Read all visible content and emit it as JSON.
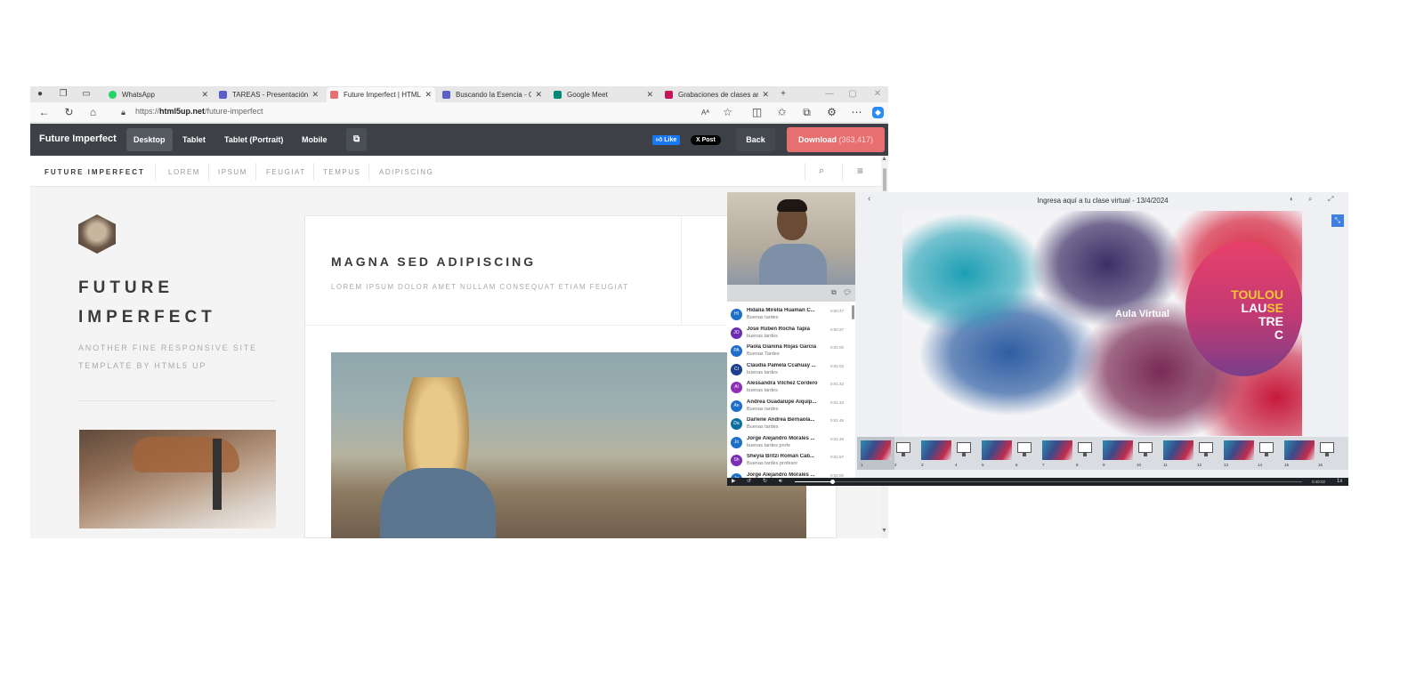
{
  "browser": {
    "tabs": [
      {
        "label": "WhatsApp",
        "color": "#25d366"
      },
      {
        "label": "TAREAS - Presentación",
        "color": "#5b5fc7"
      },
      {
        "label": "Future Imperfect | HTML",
        "color": "#e76f6f"
      },
      {
        "label": "Buscando la Esencia - Gr",
        "color": "#5b5fc7"
      },
      {
        "label": "Google Meet",
        "color": "#00897b"
      },
      {
        "label": "Grabaciones de clases ar",
        "color": "#c2185b"
      }
    ],
    "new_tab": "+",
    "url_prefix": "https://",
    "url_host": "html5up.net",
    "url_path": "/future-imperfect"
  },
  "html5up_bar": {
    "logo": "Future Imperfect",
    "view_buttons": [
      "Desktop",
      "Tablet",
      "Tablet (Portrait)",
      "Mobile"
    ],
    "like": "Like",
    "post": "X Post",
    "back": "Back",
    "download": "Download",
    "download_count": "(363,417)"
  },
  "site": {
    "title": "FUTURE IMPERFECT",
    "nav": [
      "LOREM",
      "IPSUM",
      "FEUGIAT",
      "TEMPUS",
      "ADIPISCING"
    ],
    "brand_line1": "FUTURE",
    "brand_line2": "IMPERFECT",
    "brand_sub": "ANOTHER FINE RESPONSIVE SITE TEMPLATE BY HTML5 UP",
    "post_title": "MAGNA SED ADIPISCING",
    "post_sub": "LOREM IPSUM DOLOR AMET NULLAM CONSEQUAT ETIAM FEUGIAT"
  },
  "player": {
    "title": "Ingresa aquí a tu clase virtual - 13/4/2024",
    "slide_text": "Aula Virtual",
    "logo_l1": "TOULOU",
    "logo_l2a": "LAU",
    "logo_l2b": "SE",
    "logo_l3": "TRE",
    "logo_l4": "C",
    "time": "0:40:02",
    "speed": "1x",
    "chat": [
      {
        "initials": "HI",
        "name": "Hidalia Mirella Huaman C...",
        "time": "0:00:47",
        "msg": "Buenas tardes",
        "color": "#1e6fc9"
      },
      {
        "initials": "JO",
        "name": "Jose Ruben Rocha Tapia",
        "time": "0:00:37",
        "msg": "buenas tardes",
        "color": "#6a2eb5"
      },
      {
        "initials": "PA",
        "name": "Paola Gianina Rojas Garcia",
        "time": "0:01:00",
        "msg": "Buenas Tardes",
        "color": "#1e6fc9"
      },
      {
        "initials": "CI",
        "name": "Claudia Pamela Ccahuay ...",
        "time": "0:01:03",
        "msg": "buenas tardes",
        "color": "#1e3f8f"
      },
      {
        "initials": "Al",
        "name": "Alessandra Vilchez Cordero",
        "time": "0:01:32",
        "msg": "buenas tardes",
        "color": "#8e2fb5"
      },
      {
        "initials": "An",
        "name": "Andrea Guadalupe Aiquip...",
        "time": "0:01:33",
        "msg": "Buenas tardes",
        "color": "#1e6fc9"
      },
      {
        "initials": "Da",
        "name": "Darlene Andrea Bernaola...",
        "time": "0:01:46",
        "msg": "Buenas tardes",
        "color": "#0d6fa0"
      },
      {
        "initials": "Jo",
        "name": "Jorge Alejandro Morales ...",
        "time": "0:01:46",
        "msg": "buenas tardes profe",
        "color": "#1e6fc9"
      },
      {
        "initials": "Sh",
        "name": "Sheyla Britzi Roman Cab...",
        "time": "0:01:57",
        "msg": "Buenas tardes profesor",
        "color": "#7a2eb5"
      },
      {
        "initials": "Jo",
        "name": "Jorge Alejandro Morales ...",
        "time": "0:02:00",
        "msg": "",
        "color": "#1e6fc9"
      }
    ],
    "thumb_numbers": [
      "1",
      "2",
      "3",
      "4",
      "5",
      "6",
      "7",
      "8",
      "9",
      "10",
      "11",
      "12",
      "13",
      "14",
      "15",
      "16"
    ]
  }
}
